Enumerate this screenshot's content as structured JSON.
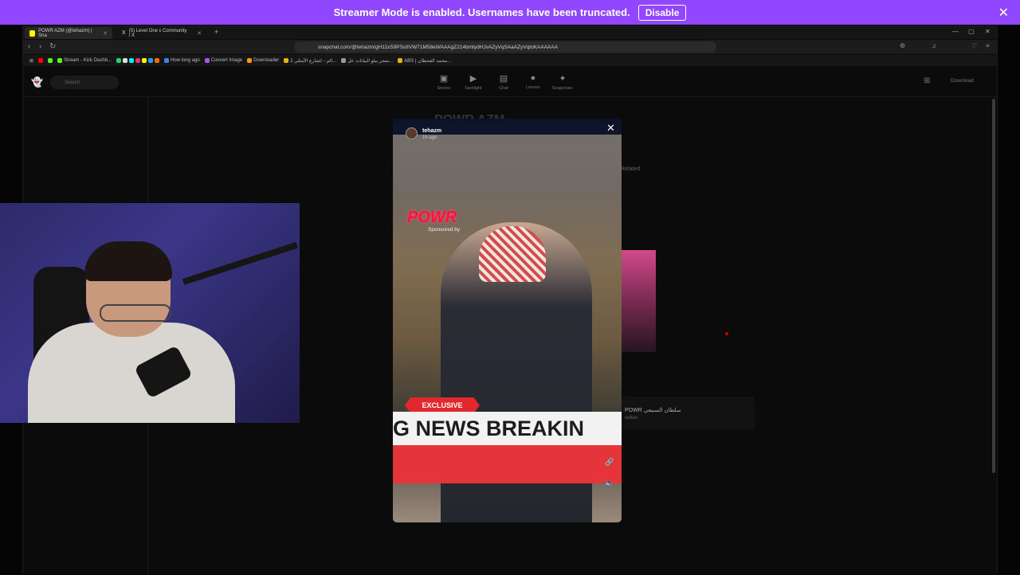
{
  "streamer_banner": {
    "message": "Streamer Mode is enabled. Usernames have been truncated.",
    "button": "Disable",
    "close": "✕"
  },
  "browser": {
    "tabs": [
      {
        "title": "POWR AZM (@tehazm) | Sna",
        "active": true
      },
      {
        "title": "(5) Level One ε Community / X",
        "active": false
      }
    ],
    "new_tab": "+",
    "window_controls": [
      "—",
      "▢",
      "✕"
    ],
    "url": "snapchat.com/@tehazm/gH11xS9PSolIVW71M58eWAAAgZ214bmtydHJvAZyVqSAaAZyVqtoKAAAAAA",
    "bookmarks": [
      {
        "label": "Stream - Kick Dashb...",
        "color": "#53fc18"
      },
      {
        "label": "How long ago",
        "color": "#3b82f6"
      },
      {
        "label": "Convert Image",
        "color": "#a855f7"
      },
      {
        "label": "Downloader",
        "color": "#f59e0b"
      },
      {
        "label": "شارع الأمثلي 2c - الم...",
        "color": "#eab308"
      },
      {
        "label": "متجر بيلو البيانات عل...",
        "color": "#999999"
      },
      {
        "label": "ABS | محمد القحطان...",
        "color": "#eab308"
      }
    ]
  },
  "snapchat": {
    "search_placeholder": "Search",
    "nav": [
      {
        "label": "Stories",
        "icon": "stories-icon"
      },
      {
        "label": "Spotlight",
        "icon": "spotlight-icon"
      },
      {
        "label": "Chat",
        "icon": "chat-icon"
      },
      {
        "label": "Lenses",
        "icon": "lenses-icon"
      },
      {
        "label": "Snapchat+",
        "icon": "snapchat-plus-icon"
      }
    ],
    "download": "Download",
    "profile_name": "POWR AZM",
    "related_tab": "Related",
    "product": {
      "name": "POWR سلطان السبيعي",
      "sub": "sultan"
    }
  },
  "story": {
    "username": "tehazm",
    "time": "1h ago",
    "logo_text": "POWR",
    "logo_sub": "Sponsored by",
    "exclusive": "EXCLUSIVE",
    "ticker": "G NEWS   BREAKIN"
  }
}
